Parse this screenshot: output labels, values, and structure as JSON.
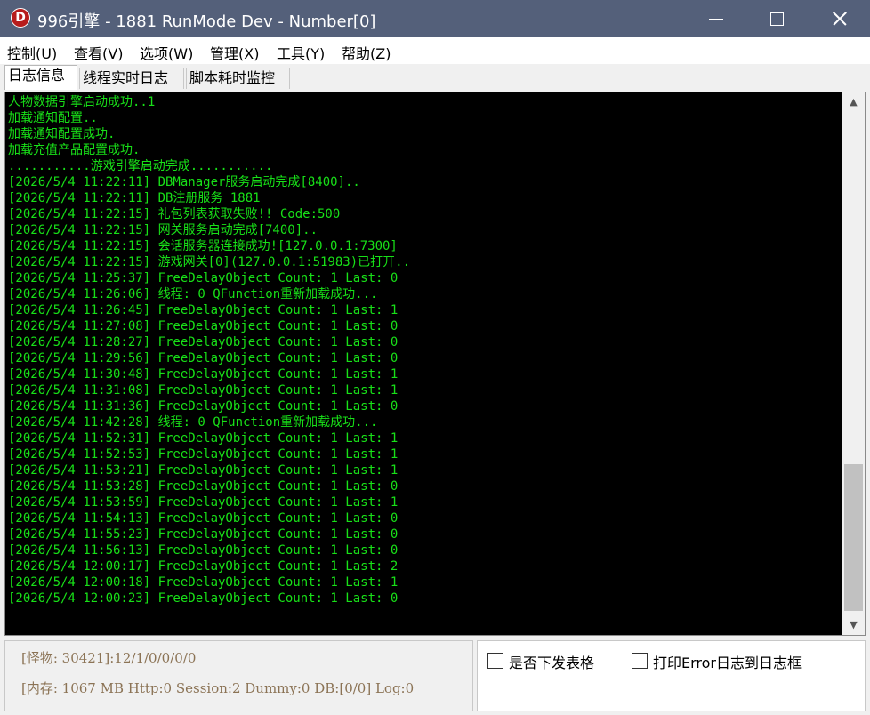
{
  "window": {
    "icon_letter": "D",
    "title": "996引擎 - 1881 RunMode Dev - Number[0]"
  },
  "menu": [
    {
      "label": "控制(U)"
    },
    {
      "label": "查看(V)"
    },
    {
      "label": "选项(W)"
    },
    {
      "label": "管理(X)"
    },
    {
      "label": "工具(Y)"
    },
    {
      "label": "帮助(Z)"
    }
  ],
  "tabs": [
    {
      "label": "日志信息",
      "active": true
    },
    {
      "label": "线程实时日志",
      "active": false
    },
    {
      "label": "脚本耗时监控",
      "active": false
    }
  ],
  "log": {
    "lines": [
      "人物数据引擎启动成功..1",
      "加载通知配置..",
      "加载通知配置成功.",
      "加载充值产品配置成功.",
      "...........游戏引擎启动完成...........",
      "[2026/5/4 11:22:11] DBManager服务启动完成[8400]..",
      "[2026/5/4 11:22:11] DB注册服务 1881",
      "[2026/5/4 11:22:15] 礼包列表获取失败!! Code:500",
      "[2026/5/4 11:22:15] 网关服务启动完成[7400]..",
      "[2026/5/4 11:22:15] 会话服务器连接成功![127.0.0.1:7300]",
      "[2026/5/4 11:22:15] 游戏网关[0](127.0.0.1:51983)已打开..",
      "[2026/5/4 11:25:37] FreeDelayObject Count: 1 Last: 0",
      "[2026/5/4 11:26:06] 线程: 0 QFunction重新加载成功...",
      "[2026/5/4 11:26:45] FreeDelayObject Count: 1 Last: 1",
      "[2026/5/4 11:27:08] FreeDelayObject Count: 1 Last: 0",
      "[2026/5/4 11:28:27] FreeDelayObject Count: 1 Last: 0",
      "[2026/5/4 11:29:56] FreeDelayObject Count: 1 Last: 0",
      "[2026/5/4 11:30:48] FreeDelayObject Count: 1 Last: 1",
      "[2026/5/4 11:31:08] FreeDelayObject Count: 1 Last: 1",
      "[2026/5/4 11:31:36] FreeDelayObject Count: 1 Last: 0",
      "[2026/5/4 11:42:28] 线程: 0 QFunction重新加载成功...",
      "[2026/5/4 11:52:31] FreeDelayObject Count: 1 Last: 1",
      "[2026/5/4 11:52:53] FreeDelayObject Count: 1 Last: 1",
      "[2026/5/4 11:53:21] FreeDelayObject Count: 1 Last: 1",
      "[2026/5/4 11:53:28] FreeDelayObject Count: 1 Last: 0",
      "[2026/5/4 11:53:59] FreeDelayObject Count: 1 Last: 1",
      "[2026/5/4 11:54:13] FreeDelayObject Count: 1 Last: 0",
      "[2026/5/4 11:55:23] FreeDelayObject Count: 1 Last: 0",
      "[2026/5/4 11:56:13] FreeDelayObject Count: 1 Last: 0",
      "[2026/5/4 12:00:17] FreeDelayObject Count: 1 Last: 2",
      "[2026/5/4 12:00:18] FreeDelayObject Count: 1 Last: 1",
      "[2026/5/4 12:00:23] FreeDelayObject Count: 1 Last: 0"
    ],
    "text_color": "#18e018",
    "background": "#000000"
  },
  "status": {
    "monster": "[怪物: 30421]:12/1/0/0/0/0",
    "memory": "[内存: 1067 MB Http:0 Session:2 Dummy:0 DB:[0/0] Log:0"
  },
  "options": {
    "send_table": {
      "label": "是否下发表格",
      "checked": false
    },
    "print_error": {
      "label": "打印Error日志到日志框",
      "checked": false
    }
  },
  "colors": {
    "titlebar": "#54607a",
    "status_text": "#8b7355"
  }
}
